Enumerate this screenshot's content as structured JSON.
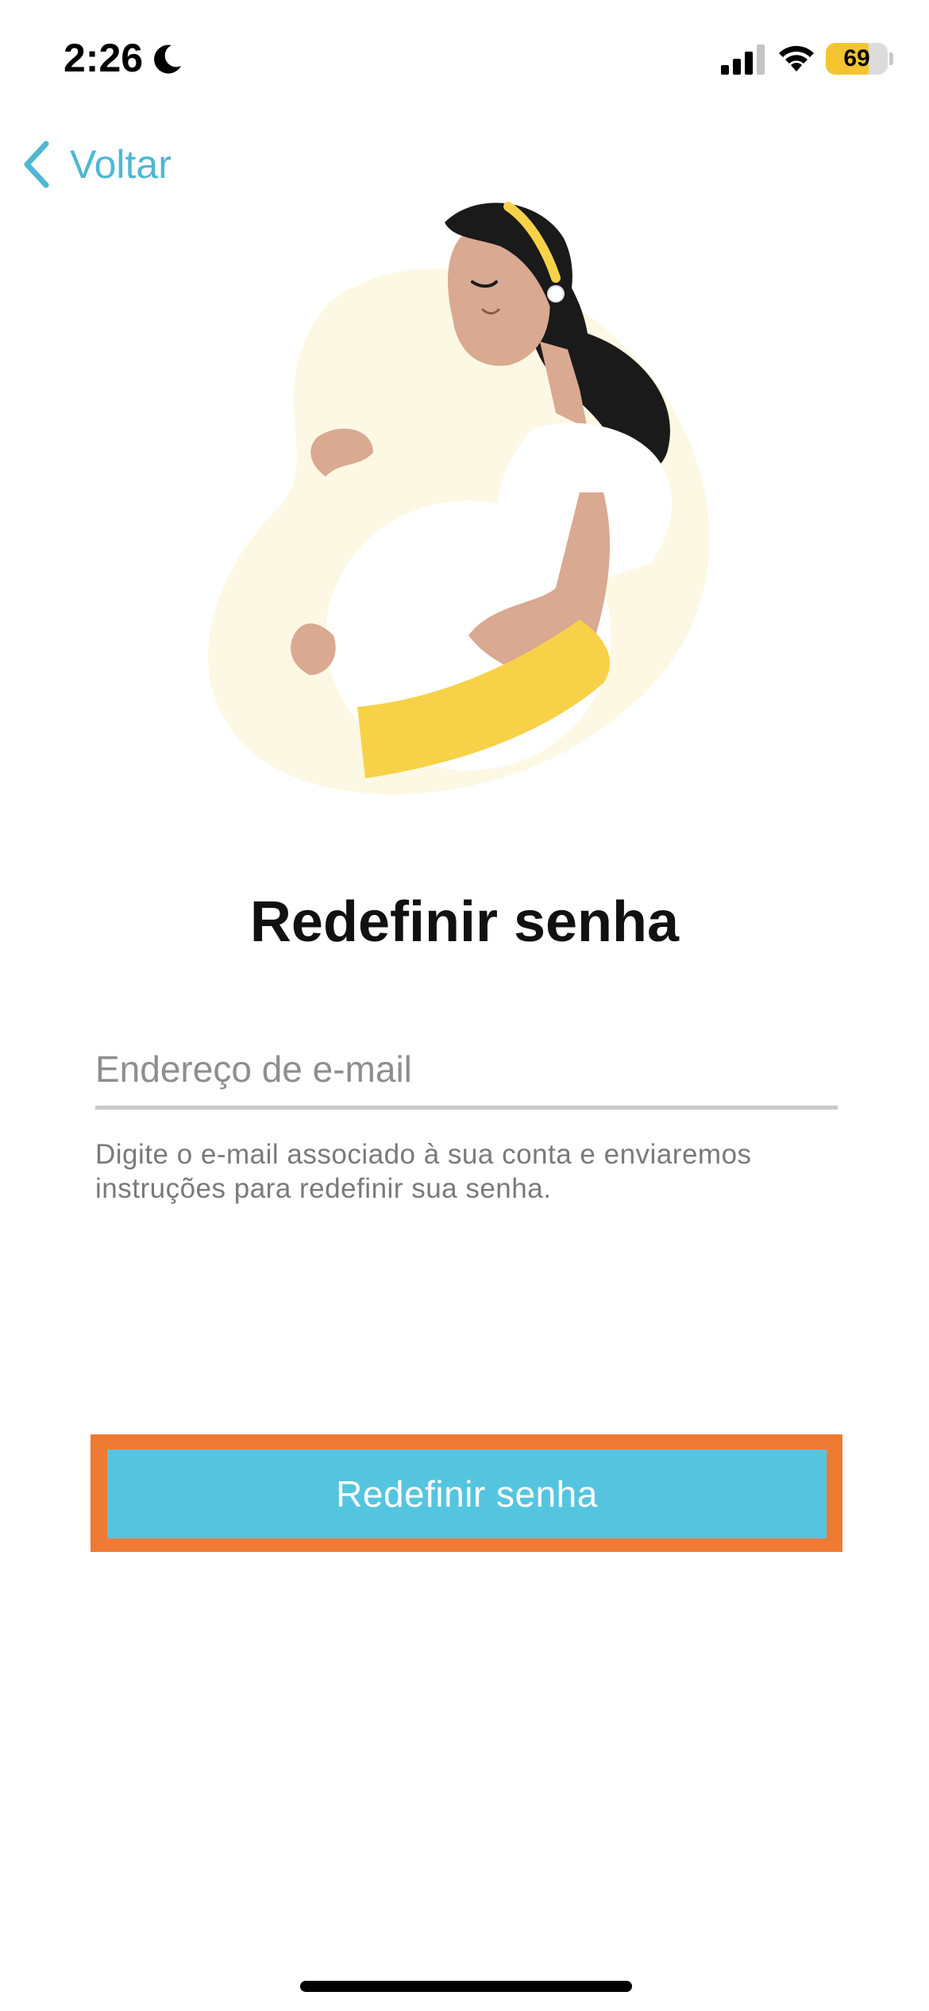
{
  "status_bar": {
    "time": "2:26",
    "battery_level": "69",
    "battery_fraction": 0.69,
    "battery_color": "#f4c430"
  },
  "nav": {
    "back_label": "Voltar",
    "back_icon": "chevron-left-icon",
    "accent_color": "#4fb7d4"
  },
  "page": {
    "title": "Redefinir senha",
    "illustration": "pregnant-woman-illustration"
  },
  "form": {
    "email_placeholder": "Endereço de e-mail",
    "email_value": "",
    "helper_text": "Digite o e-mail associado à sua conta e enviaremos instruções para redefinir sua senha.",
    "submit_label": "Redefinir senha",
    "button_color": "#55c5df",
    "highlight_color": "#ef7a33"
  }
}
